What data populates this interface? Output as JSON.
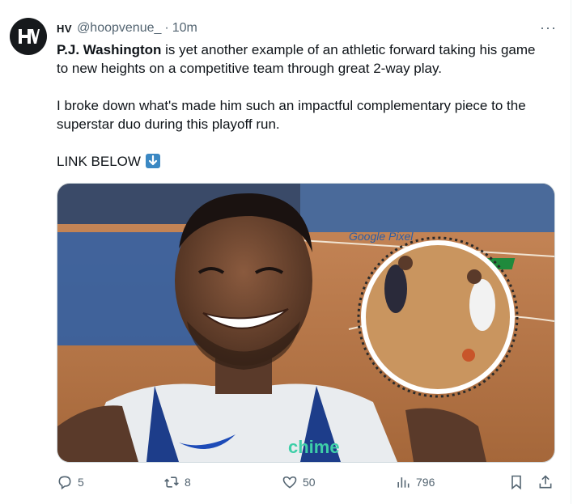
{
  "tweet": {
    "author": {
      "display_name": "HV",
      "handle": "@hoopvenue_",
      "separator": "·",
      "time": "10m",
      "avatar_text": "HV"
    },
    "more_label": "···",
    "text": {
      "p1_bold": "P.J. Washington",
      "p1_rest": " is yet another example of an athletic forward taking his game to new heights on a competitive team through great 2-way play.",
      "p2": "I broke down what's made him such an impactful complementary piece to the superstar duo during this playoff run.",
      "p3": "LINK BELOW",
      "p3_emoji": "down-arrow-emoji"
    },
    "media": {
      "jersey_sponsor": "chime",
      "court_sponsor": "Google Pixel"
    },
    "actions": {
      "replies": "5",
      "reposts": "8",
      "likes": "50",
      "views": "796"
    }
  },
  "colors": {
    "text": "#0f1419",
    "muted": "#536471",
    "avatar_bg": "#16191c",
    "emoji_blue": "#3b88c3"
  }
}
